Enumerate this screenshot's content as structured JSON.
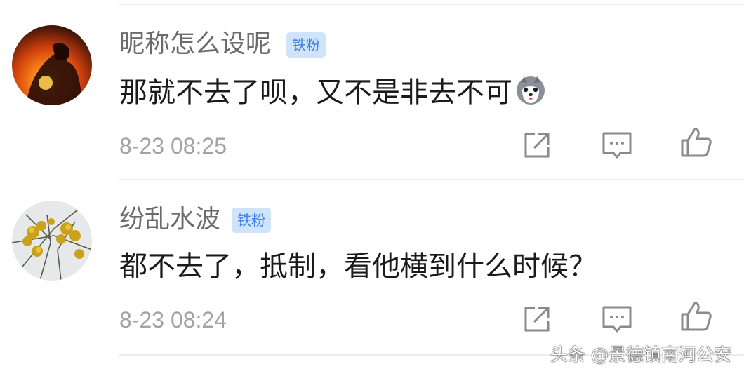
{
  "comments": [
    {
      "username": "昵称怎么设呢",
      "badge": "铁粉",
      "content": "那就不去了呗，又不是非去不可",
      "emoji_icon": "husky-face-emoji-icon",
      "time": "8-23 08:25"
    },
    {
      "username": "纷乱水波",
      "badge": "铁粉",
      "content": "都不去了，抵制，看他横到什么时候？",
      "time": "8-23 08:24"
    }
  ],
  "actions": [
    "share-icon",
    "reply-icon",
    "like-icon"
  ],
  "watermark": "头条 @景德镇南河公安",
  "colors": {
    "badge_bg": "#cfe3fb",
    "badge_text": "#3f82e0",
    "username": "#6b6b6b",
    "time": "#a3a3a3"
  }
}
